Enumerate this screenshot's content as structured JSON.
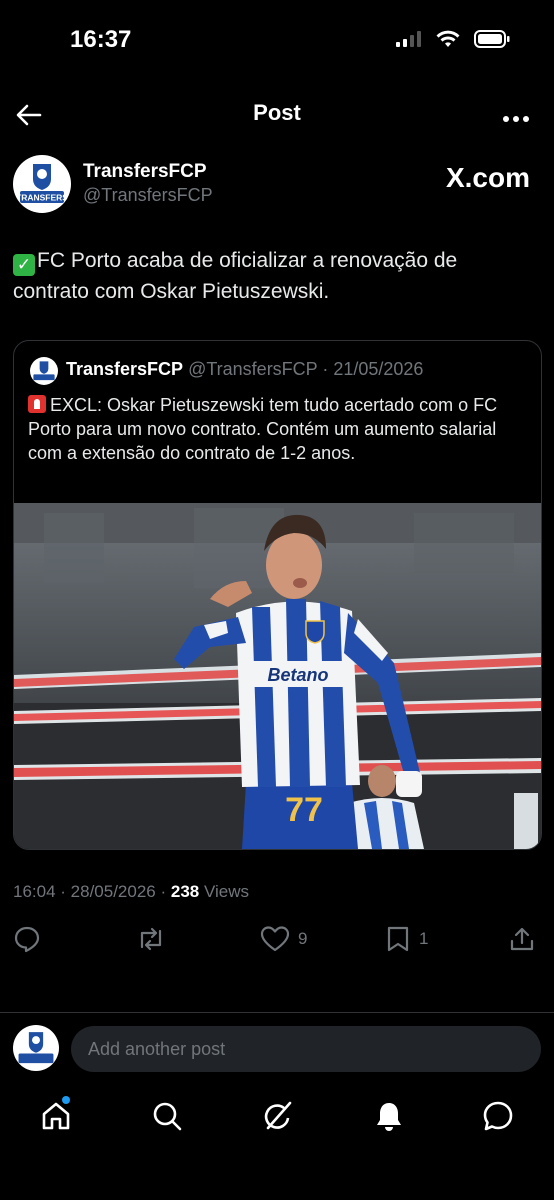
{
  "status_bar": {
    "time": "16:37"
  },
  "header": {
    "title": "Post"
  },
  "author": {
    "name": "TransfersFCP",
    "handle": "@TransfersFCP",
    "avatar_text": "TRANSFERS"
  },
  "watermark": "X.com",
  "tweet": {
    "text": "FC Porto acaba de oficializar a renovação de contrato com Oskar Pietuszewski."
  },
  "quoted": {
    "name": "TransfersFCP",
    "handle": "@TransfersFCP",
    "date": "21/05/2026",
    "text": "EXCL: Oskar Pietuszewski tem tudo acertado com o FC Porto para um novo contrato. Contém um aumento salarial com a extensão do contrato de 1-2 anos.",
    "image": {
      "sponsor": "Betano",
      "shirt_number": "77"
    }
  },
  "meta": {
    "time": "16:04",
    "date": "28/05/2026",
    "views_count": "238",
    "views_label": "Views"
  },
  "actions": {
    "likes": "9",
    "bookmarks": "1"
  },
  "reply": {
    "placeholder": "Add another post"
  },
  "colors": {
    "accent": "#1d9bf0",
    "background": "#000000",
    "muted": "#71767b",
    "porto_blue": "#1e4fa3"
  },
  "icons": [
    "back-arrow-icon",
    "more-icon",
    "reply-icon",
    "repost-icon",
    "like-icon",
    "bookmark-icon",
    "share-icon",
    "home-icon",
    "search-icon",
    "grok-icon",
    "notifications-icon",
    "messages-icon"
  ]
}
